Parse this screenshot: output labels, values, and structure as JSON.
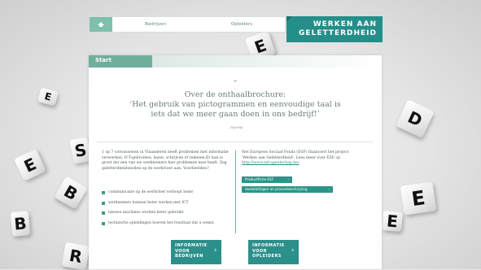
{
  "nav": {
    "items": [
      "Bedrijven",
      "Opleiders"
    ]
  },
  "brand": {
    "line1": "WERKEN AAN",
    "line2": "GELETTERDHEID"
  },
  "page": {
    "section_title": "Start",
    "quote_mark": "“",
    "quote_intro": "Over de onthaalbrochure:",
    "quote_line1": "‘Het gebruik van pictogrammen en eenvoudige taal is",
    "quote_line2": "iets dat we meer gaan doen in ons bedrijf!’",
    "quote_author": "– Myrella",
    "left_paragraph": "1 op 7 volwassenen in Vlaanderen heeft problemen met informatie verwerken, ICT-gebruiken, lezen, schrijven of rekenen.Er kan is groot dat een van uw werknemers hier problemen mee heeft. Zeg geletterdheidsnoden op de werkvloer aan. Voorbeelden?",
    "bullets": [
      "communicatie op de werkvloer verloopt beter",
      "werknemers kunnen beter werken met ICT",
      "nieuwe machines worden beter gebruikt",
      "technische opleidingen hoeven het resultaat dat u wenst."
    ],
    "right_paragraph": "Het Europees Sociaal Fonds (ESF) financiert het project 'Werken aan Geletterdheid'. Lees meer over ESF op",
    "right_link": "http://www.esf-agentschap.be/",
    "pill1": "Productfiche ESF",
    "pill2": "doelstellingen en procesbeschrijving",
    "cta1_line1": "INFORMATIE",
    "cta1_line2": "VOOR",
    "cta1_line3": "BEDRIJVEN",
    "cta2_line1": "INFORMATIE",
    "cta2_line2": "VOOR",
    "cta2_line3": "OPLEIDERS"
  },
  "tiles": [
    "E",
    "E",
    "S",
    "B",
    "E",
    "B",
    "R",
    "D",
    "E",
    "E"
  ],
  "colors": {
    "accent": "#248f88",
    "accent_light": "#7fbfae"
  }
}
